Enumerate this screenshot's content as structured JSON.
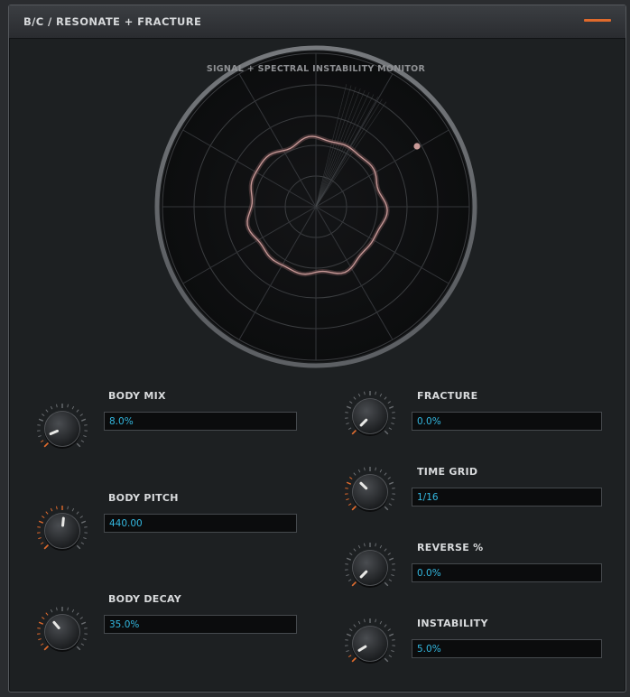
{
  "window": {
    "title": "B/C  /  RESONATE + FRACTURE"
  },
  "monitor": {
    "title": "SIGNAL + SPECTRAL INSTABILITY MONITOR"
  },
  "colors": {
    "accent": "#e06a2c",
    "value": "#33b8e0",
    "trace": "#c99a98"
  },
  "icons": {
    "menu": "hamburger-menu-icon"
  },
  "params": [
    {
      "id": "body-mix",
      "label": "BODY MIX",
      "value": "8.0%",
      "level": 0.08
    },
    {
      "id": "body-pitch",
      "label": "BODY PITCH",
      "value": "440.00",
      "level": 0.52
    },
    {
      "id": "body-decay",
      "label": "BODY DECAY",
      "value": "35.0%",
      "level": 0.35
    },
    {
      "id": "fracture",
      "label": "FRACTURE",
      "value": "0.0%",
      "level": 0.0
    },
    {
      "id": "time-grid",
      "label": "TIME GRID",
      "value": "1/16",
      "level": 0.33
    },
    {
      "id": "reverse",
      "label": "REVERSE %",
      "value": "0.0%",
      "level": 0.0
    },
    {
      "id": "instability",
      "label": "INSTABILITY",
      "value": "5.0%",
      "level": 0.05
    }
  ]
}
